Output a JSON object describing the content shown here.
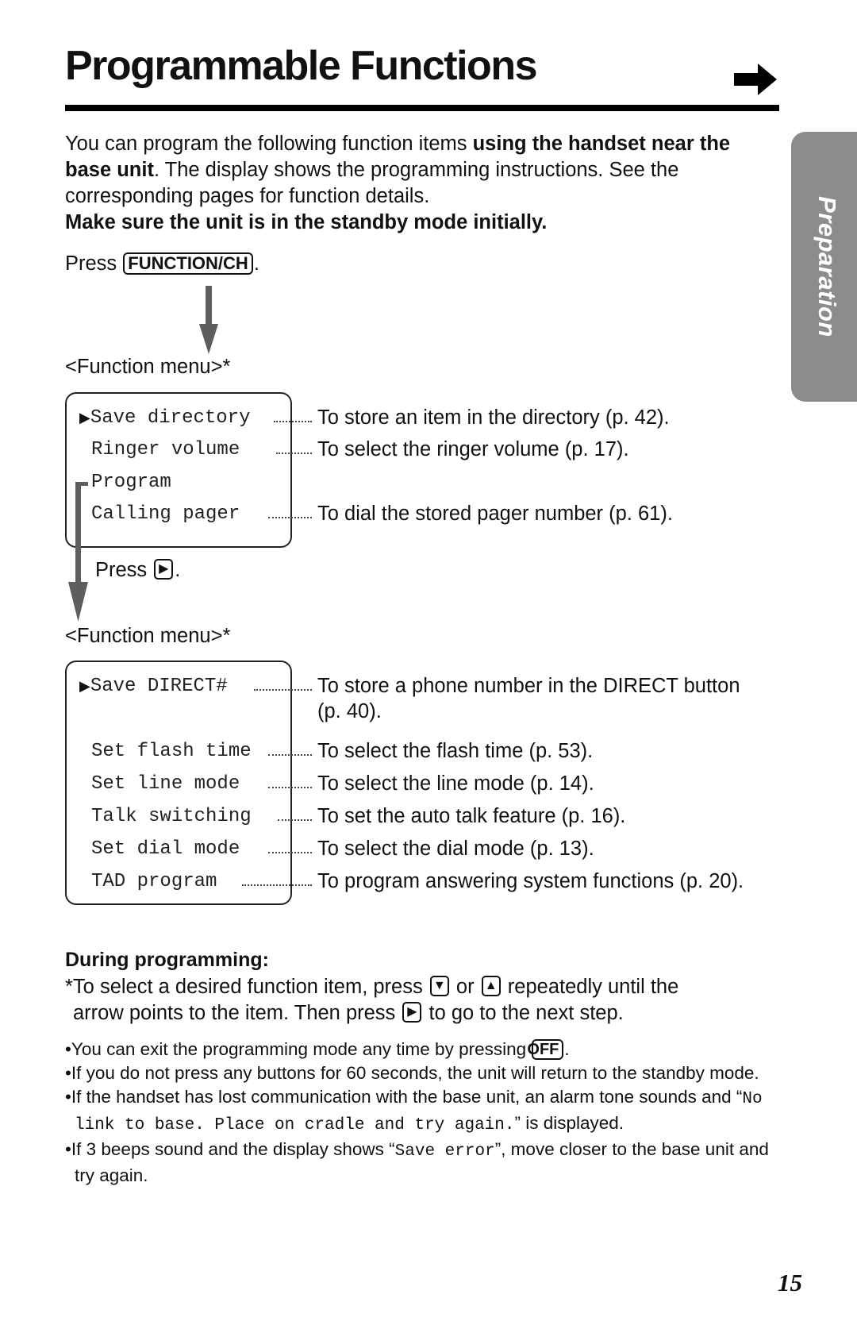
{
  "header": {
    "title": "Programmable Functions",
    "continue_icon": "right-arrow-icon"
  },
  "side_tab": {
    "label": "Preparation"
  },
  "intro": {
    "part1": "You can program the following function items ",
    "bold1": "using the handset near the base unit",
    "part2": ". The display shows the programming instructions. See the corresponding pages for function details.",
    "bold2": "Make sure the unit is in the standby mode initially."
  },
  "step1": {
    "press_label": "Press",
    "key": "FUNCTION/CH",
    "suffix": "."
  },
  "menu1": {
    "label": "<Function menu>*",
    "items": [
      {
        "text": "Save directory",
        "selected": true,
        "description": "To store an item in the directory (p. 42)."
      },
      {
        "text": "Ringer volume",
        "selected": false,
        "description": "To select the ringer volume (p. 17)."
      },
      {
        "text": "Program",
        "selected": false,
        "description": ""
      },
      {
        "text": "Calling pager",
        "selected": false,
        "description": "To dial the stored pager number (p. 61)."
      }
    ]
  },
  "step2": {
    "press_label": "Press",
    "key_icon": "right-triangle-icon",
    "suffix": "."
  },
  "menu2": {
    "label": "<Function menu>*",
    "items": [
      {
        "text": "Save DIRECT#",
        "selected": true,
        "description": "To store a phone number in the DIRECT button",
        "description2": "(p. 40)."
      },
      {
        "text": "Set flash time",
        "selected": false,
        "description": "To select the flash time (p. 53)."
      },
      {
        "text": "Set line mode",
        "selected": false,
        "description": "To select the line mode (p. 14)."
      },
      {
        "text": "Talk switching",
        "selected": false,
        "description": "To set the auto talk feature (p. 16)."
      },
      {
        "text": "Set dial mode",
        "selected": false,
        "description": "To select the dial mode (p. 13)."
      },
      {
        "text": "TAD program",
        "selected": false,
        "description": "To program answering system functions (p. 20)."
      }
    ]
  },
  "during": {
    "heading": "During programming:",
    "line1_a": "*To select a desired function item, press",
    "line1_or": "or",
    "line1_b": "repeatedly until the",
    "line2_a": "arrow points to the item. Then press",
    "line2_b": "to go to the next step."
  },
  "notes": {
    "n1_a": "You can exit the programming mode any time by pressing",
    "n1_key": "OFF",
    "n1_b": ".",
    "n2": "If you do not press any buttons for 60 seconds, the unit will return to the standby mode.",
    "n3_a": "If the handset has lost communication with the base unit, an alarm tone sounds and “",
    "n3_mono": "No link to base. Place on cradle and try again.",
    "n3_b": "” is displayed.",
    "n4_a": "If 3 beeps sound and the display shows “",
    "n4_mono": "Save error",
    "n4_b": "”, move closer to the base unit and try again."
  },
  "footer": {
    "page_number": "15"
  }
}
